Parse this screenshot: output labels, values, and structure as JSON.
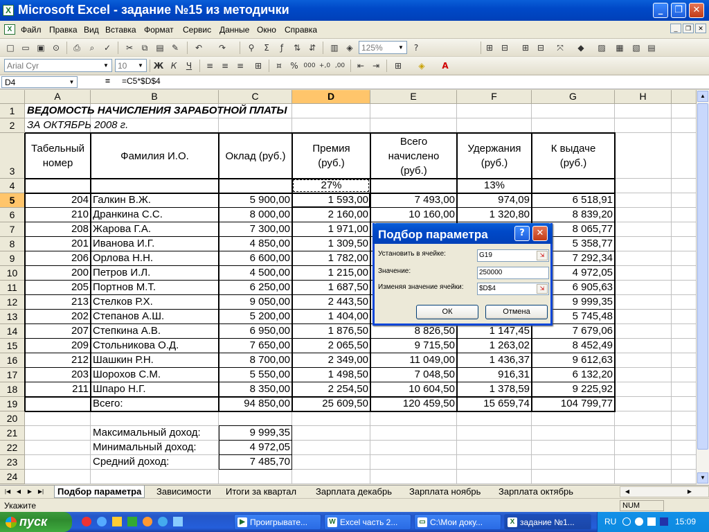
{
  "window": {
    "title": "Microsoft Excel - задание №15 из методички"
  },
  "menu": [
    "Файл",
    "Правка",
    "Вид",
    "Вставка",
    "Формат",
    "Сервис",
    "Данные",
    "Окно",
    "Справка"
  ],
  "toolbar": {
    "zoom": "125%",
    "font": "Arial Cyr",
    "size": "10"
  },
  "formula_bar": {
    "cell": "D4",
    "formula": "=C5*$D$4"
  },
  "columns": [
    "A",
    "B",
    "C",
    "D",
    "E",
    "F",
    "G",
    "H"
  ],
  "rows": [
    "1",
    "2",
    "3",
    "4",
    "5",
    "6",
    "7",
    "8",
    "9",
    "10",
    "11",
    "12",
    "13",
    "14",
    "15",
    "16",
    "17",
    "18",
    "19",
    "20",
    "21",
    "22",
    "23",
    "24"
  ],
  "sheet": {
    "title1": "ВЕДОМОСТЬ НАЧИСЛЕНИЯ ЗАРАБОТНОЙ ПЛАТЫ",
    "title2": "ЗА ОКТЯБРЬ 2008 г.",
    "headers": {
      "a": [
        "Табельный",
        "номер"
      ],
      "b": "Фамилия И.О.",
      "c": "Оклад (руб.)",
      "d": [
        "Премия",
        "(руб.)"
      ],
      "e": [
        "Всего",
        "начислено",
        "(руб.)"
      ],
      "f": [
        "Удержания",
        "(руб.)"
      ],
      "g": [
        "К выдаче",
        "(руб.)"
      ]
    },
    "pct_d": "27%",
    "pct_f": "13%",
    "data": [
      [
        "204",
        "Галкин В.Ж.",
        "5 900,00",
        "1 593,00",
        "7 493,00",
        "974,09",
        "6 518,91"
      ],
      [
        "210",
        "Дранкина С.С.",
        "8 000,00",
        "2 160,00",
        "10 160,00",
        "1 320,80",
        "8 839,20"
      ],
      [
        "208",
        "Жарова Г.А.",
        "7 300,00",
        "1 971,00",
        "",
        "",
        "8 065,77"
      ],
      [
        "201",
        "Иванова И.Г.",
        "4 850,00",
        "1 309,50",
        "",
        "",
        "5 358,77"
      ],
      [
        "206",
        "Орлова Н.Н.",
        "6 600,00",
        "1 782,00",
        "",
        "",
        "7 292,34"
      ],
      [
        "200",
        "Петров И.Л.",
        "4 500,00",
        "1 215,00",
        "",
        "",
        "4 972,05"
      ],
      [
        "205",
        "Портнов М.Т.",
        "6 250,00",
        "1 687,50",
        "",
        "",
        "6 905,63"
      ],
      [
        "213",
        "Стелков Р.Х.",
        "9 050,00",
        "2 443,50",
        "",
        "",
        "9 999,35"
      ],
      [
        "202",
        "Степанов А.Ш.",
        "5 200,00",
        "1 404,00",
        "",
        "",
        "5 745,48"
      ],
      [
        "207",
        "Степкина А.В.",
        "6 950,00",
        "1 876,50",
        "8 826,50",
        "1 147,45",
        "7 679,06"
      ],
      [
        "209",
        "Стольникова О.Д.",
        "7 650,00",
        "2 065,50",
        "9 715,50",
        "1 263,02",
        "8 452,49"
      ],
      [
        "212",
        "Шашкин Р.Н.",
        "8 700,00",
        "2 349,00",
        "11 049,00",
        "1 436,37",
        "9 612,63"
      ],
      [
        "203",
        "Шорохов С.М.",
        "5 550,00",
        "1 498,50",
        "7 048,50",
        "916,31",
        "6 132,20"
      ],
      [
        "211",
        "Шпаро Н.Г.",
        "8 350,00",
        "2 254,50",
        "10 604,50",
        "1 378,59",
        "9 225,92"
      ]
    ],
    "total": [
      "Всего:",
      "94 850,00",
      "25 609,50",
      "120 459,50",
      "15 659,74",
      "104 799,77"
    ],
    "stats": [
      [
        "Максимальный доход:",
        "9 999,35"
      ],
      [
        "Минимальный доход:",
        "4 972,05"
      ],
      [
        "Средний доход:",
        "7 485,70"
      ]
    ]
  },
  "sheet_tabs": [
    "Подбор параметра",
    "Зависимости",
    "Итоги за квартал",
    "Зарплата декабрь",
    "Зарплата ноябрь",
    "Зарплата октябрь"
  ],
  "status": {
    "left": "Укажите",
    "num": "NUM"
  },
  "dialog": {
    "title": "Подбор параметра",
    "set_cell_label": "Установить в ячейке:",
    "set_cell_value": "G19",
    "value_label": "Значение:",
    "value_value": "250000",
    "changing_label": "Изменяя значение ячейки:",
    "changing_value": "$D$4",
    "ok": "ОК",
    "cancel": "Отмена"
  },
  "taskbar": {
    "start": "пуск",
    "tasks": [
      "Проигрывате...",
      "Excel часть 2...",
      "C:\\Мои доку...",
      "задание №1..."
    ],
    "lang": "RU",
    "clock": "15:09"
  }
}
